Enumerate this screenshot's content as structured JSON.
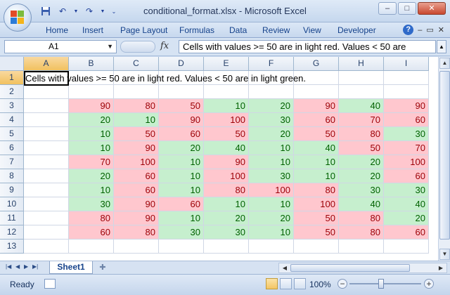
{
  "window": {
    "title": "conditional_format.xlsx - Microsoft Excel",
    "minimize": "–",
    "maximize": "□",
    "close": "✕"
  },
  "quick_access": {
    "save_icon": "save-icon",
    "undo_icon": "undo-icon",
    "redo_icon": "redo-icon",
    "customize_icon": "chevron-down-icon"
  },
  "ribbon": {
    "tabs": [
      "Home",
      "Insert",
      "Page Layout",
      "Formulas",
      "Data",
      "Review",
      "View",
      "Developer"
    ],
    "help": "?"
  },
  "formula_bar": {
    "name_box": "A1",
    "fx_label": "fx",
    "formula": "Cells with values >= 50 are in light red. Values < 50 are"
  },
  "grid": {
    "columns": [
      "A",
      "B",
      "C",
      "D",
      "E",
      "F",
      "G",
      "H",
      "I"
    ],
    "rows": [
      "1",
      "2",
      "3",
      "4",
      "5",
      "6",
      "7",
      "8",
      "9",
      "10",
      "11",
      "12",
      "13"
    ],
    "a1_text": "Cells with values >= 50 are in light red. Values < 50 are in light green.",
    "data_rows": [
      [
        90,
        80,
        50,
        10,
        20,
        90,
        40,
        90
      ],
      [
        20,
        10,
        90,
        100,
        30,
        60,
        70,
        60
      ],
      [
        10,
        50,
        60,
        50,
        20,
        50,
        80,
        30
      ],
      [
        10,
        90,
        20,
        40,
        10,
        40,
        50,
        70
      ],
      [
        70,
        100,
        10,
        90,
        10,
        10,
        20,
        100
      ],
      [
        20,
        60,
        10,
        100,
        30,
        10,
        20,
        60
      ],
      [
        10,
        60,
        10,
        80,
        100,
        80,
        30,
        30
      ],
      [
        30,
        90,
        60,
        10,
        10,
        100,
        40,
        40
      ],
      [
        80,
        90,
        10,
        20,
        20,
        50,
        80,
        20
      ],
      [
        60,
        80,
        30,
        30,
        10,
        50,
        80,
        60
      ]
    ],
    "threshold": 50,
    "high_color": "#ffc7ce",
    "low_color": "#c6efce"
  },
  "sheet_tabs": {
    "active": "Sheet1"
  },
  "status": {
    "ready": "Ready",
    "zoom": "100%",
    "zoom_minus": "−",
    "zoom_plus": "+"
  }
}
